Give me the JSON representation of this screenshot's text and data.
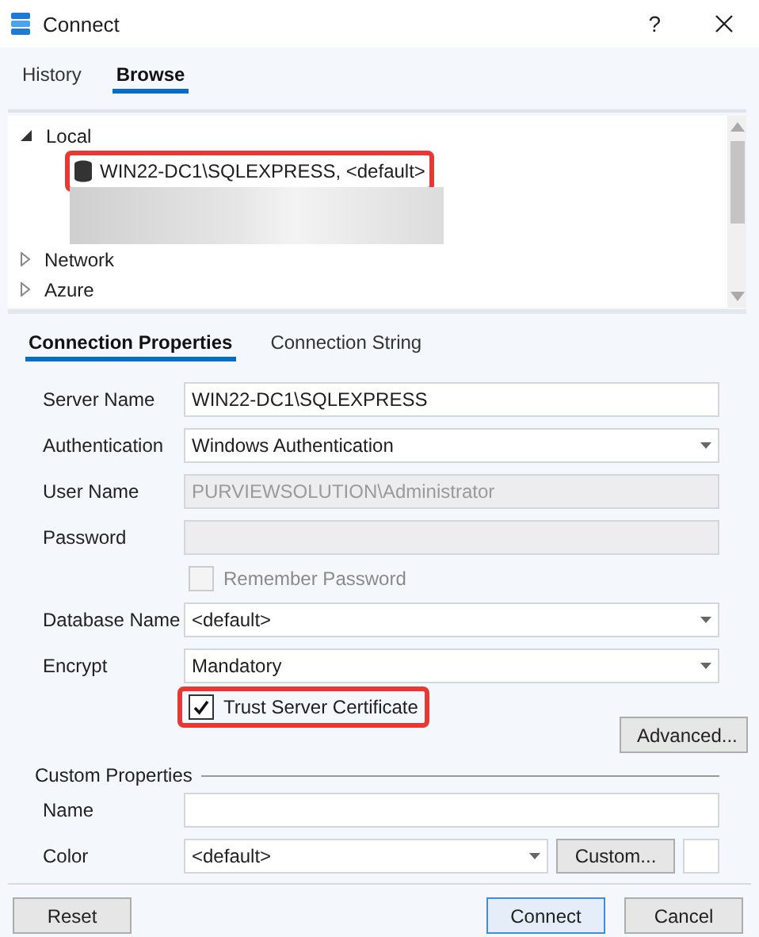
{
  "window": {
    "title": "Connect",
    "help": "?"
  },
  "tabs": [
    {
      "label": "History",
      "selected": false
    },
    {
      "label": "Browse",
      "selected": true
    }
  ],
  "tree": {
    "items": [
      {
        "label": "Local",
        "expanded": true,
        "children": [
          {
            "kind": "server",
            "label": "WIN22-DC1\\SQLEXPRESS, <default>",
            "highlighted": true
          },
          {
            "kind": "redacted",
            "highlighted": false
          }
        ]
      },
      {
        "label": "Network",
        "expanded": false
      },
      {
        "label": "Azure",
        "expanded": false
      }
    ]
  },
  "properties_tabs": [
    {
      "label": "Connection Properties",
      "selected": true
    },
    {
      "label": "Connection String",
      "selected": false
    }
  ],
  "fields": [
    {
      "kind": "text",
      "label": "Server Name",
      "value": "WIN22-DC1\\SQLEXPRESS",
      "disabled": false
    },
    {
      "kind": "dropdown",
      "label": "Authentication",
      "value": "Windows Authentication",
      "disabled": false
    },
    {
      "kind": "text",
      "label": "User Name",
      "value": "PURVIEWSOLUTION\\Administrator",
      "disabled": true
    },
    {
      "kind": "text",
      "label": "Password",
      "disabled": true
    },
    {
      "kind": "checkbox",
      "label": "Remember Password",
      "checked": false,
      "disabled": true,
      "highlighted": false
    },
    {
      "kind": "dropdown",
      "label": "Database Name",
      "value": "<default>",
      "disabled": false
    },
    {
      "kind": "dropdown",
      "label": "Encrypt",
      "value": "Mandatory",
      "disabled": false
    },
    {
      "kind": "checkbox",
      "label": "Trust Server Certificate",
      "checked": true,
      "disabled": false,
      "highlighted": true
    }
  ],
  "advanced_button": "Advanced...",
  "custom_properties": {
    "title": "Custom Properties",
    "name_label": "Name",
    "color_label": "Color",
    "color_value": "<default>",
    "custom_button": "Custom..."
  },
  "buttons": [
    {
      "label": "Reset",
      "kind": "secondary"
    },
    {
      "label": "Connect",
      "kind": "default"
    },
    {
      "label": "Cancel",
      "kind": "secondary"
    }
  ]
}
